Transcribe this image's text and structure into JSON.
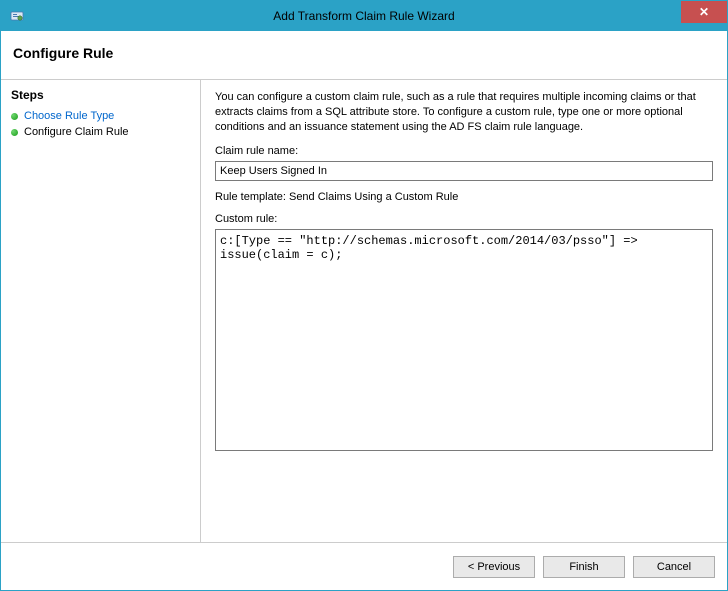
{
  "window": {
    "title": "Add Transform Claim Rule Wizard",
    "close": "✕"
  },
  "header": {
    "title": "Configure Rule"
  },
  "sidebar": {
    "title": "Steps",
    "items": [
      {
        "label": "Choose Rule Type",
        "active": false
      },
      {
        "label": "Configure Claim Rule",
        "active": true
      }
    ]
  },
  "main": {
    "description": "You can configure a custom claim rule, such as a rule that requires multiple incoming claims or that extracts claims from a SQL attribute store. To configure a custom rule, type one or more optional conditions and an issuance statement using the AD FS claim rule language.",
    "name_label": "Claim rule name:",
    "name_value": "Keep Users Signed In",
    "template_text": "Rule template: Send Claims Using a Custom Rule",
    "custom_label": "Custom rule:",
    "custom_value": "c:[Type == \"http://schemas.microsoft.com/2014/03/psso\"] => issue(claim = c);"
  },
  "footer": {
    "previous": "< Previous",
    "finish": "Finish",
    "cancel": "Cancel"
  }
}
